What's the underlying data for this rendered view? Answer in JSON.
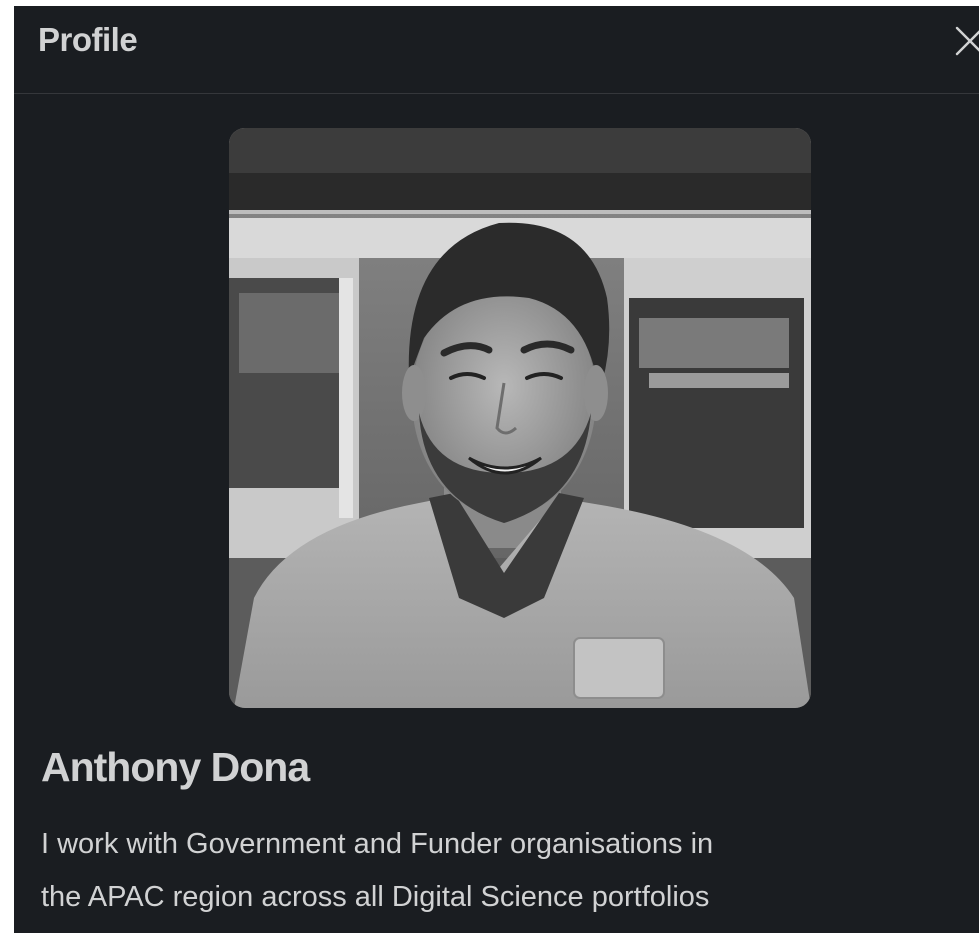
{
  "panel": {
    "title": "Profile",
    "close_icon": "close-icon"
  },
  "profile": {
    "photo_icon": "profile-photo",
    "name": "Anthony Dona",
    "bio_line_1": "I work with Government and Funder organisations in",
    "bio_line_2": "the APAC region across all Digital Science portfolios"
  },
  "colors": {
    "panel_background": "#1a1d21",
    "text": "#d1d2d3",
    "divider": "#35373b"
  }
}
